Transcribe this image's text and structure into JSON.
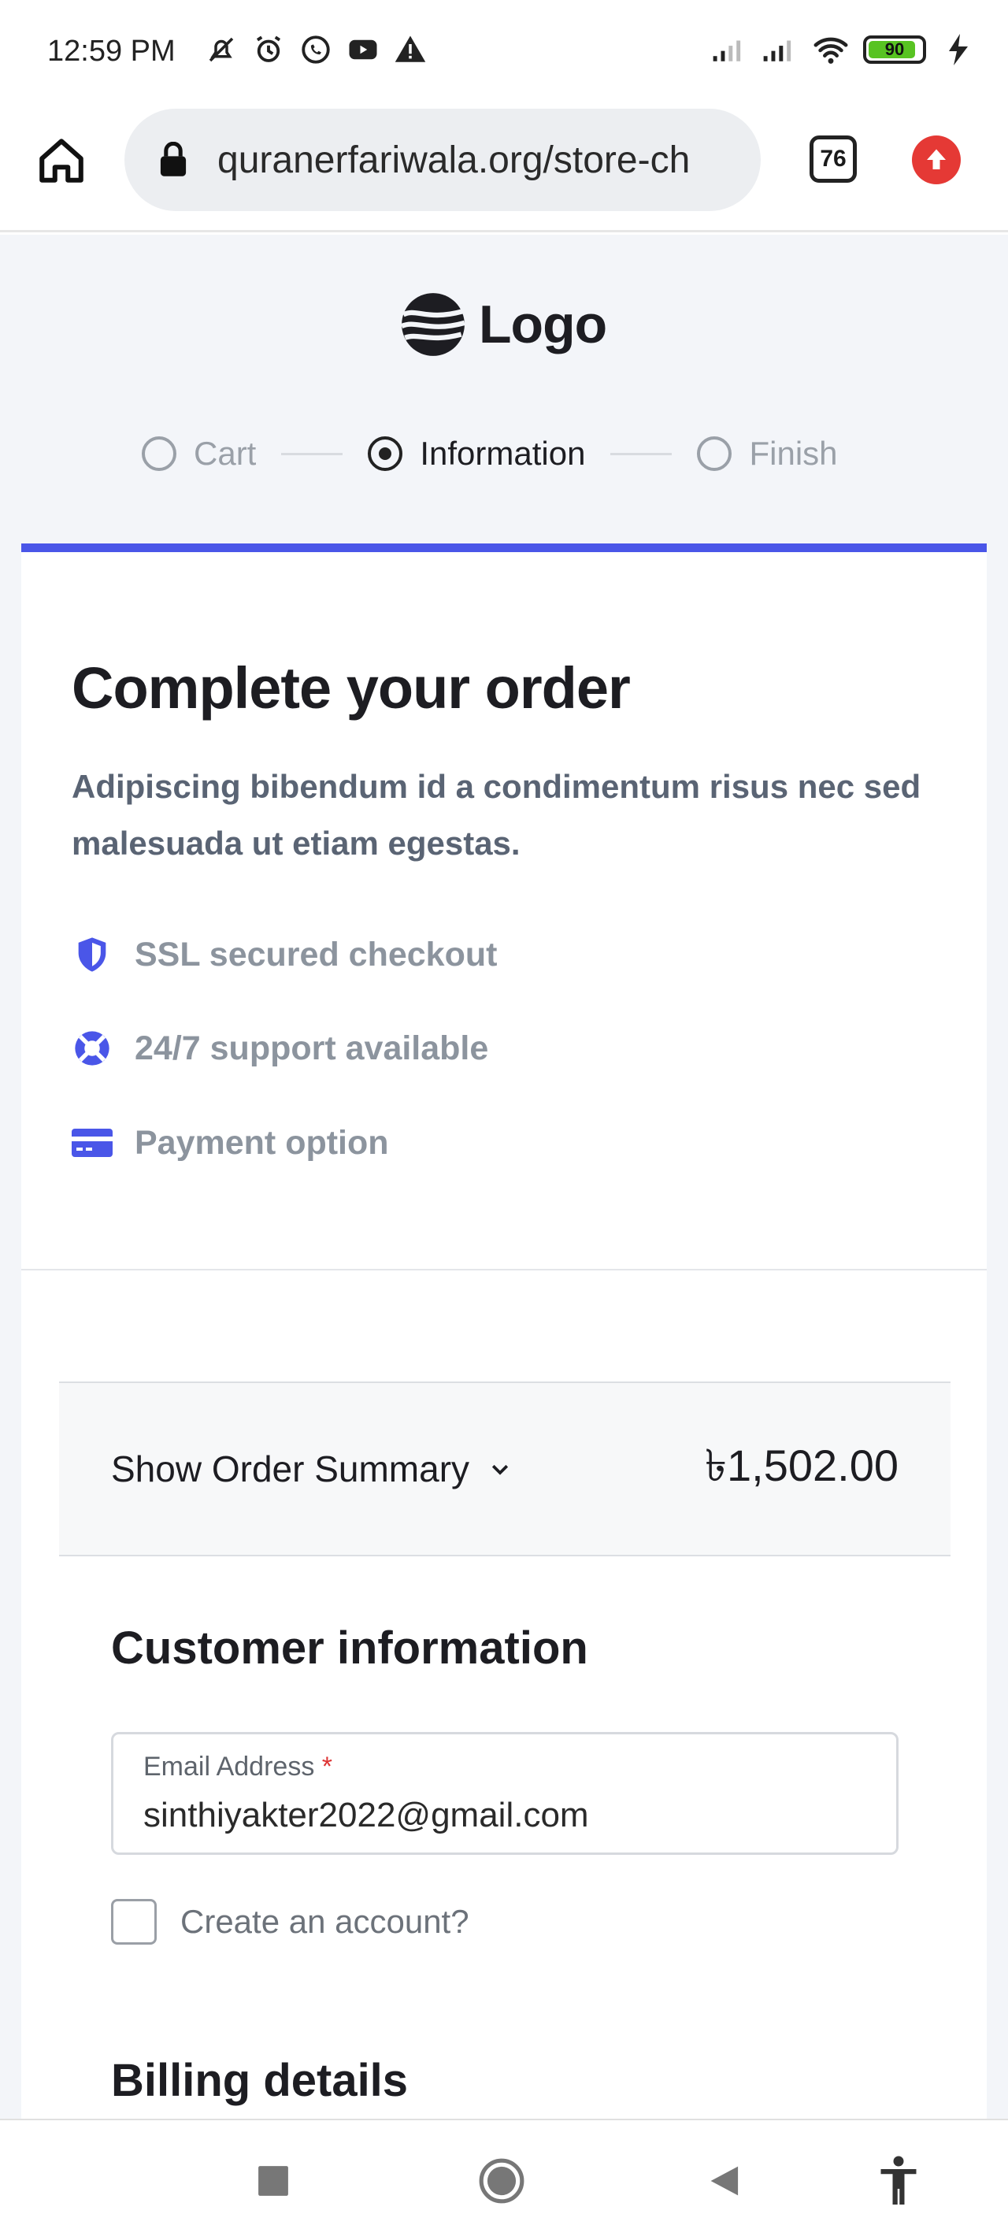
{
  "status_bar": {
    "time": "12:59 PM",
    "battery": "90",
    "battery_level": 0.9,
    "icons": [
      "mute-icon",
      "alarm-icon",
      "whatsapp-icon",
      "youtube-icon",
      "warning-icon",
      "signal-icon",
      "signal-icon",
      "wifi-icon",
      "battery-icon",
      "charging-icon"
    ]
  },
  "browser": {
    "url": "quranerfariwala.org/store-ch",
    "tab_count": "76"
  },
  "page": {
    "logo_text": "Logo",
    "steps": [
      {
        "label": "Cart",
        "state": "inactive"
      },
      {
        "label": "Information",
        "state": "active"
      },
      {
        "label": "Finish",
        "state": "inactive"
      }
    ],
    "accent_color": "#4a56e8",
    "title": "Complete your order",
    "subtitle": "Adipiscing bibendum id a condimentum risus nec sed malesuada ut etiam egestas.",
    "features": [
      {
        "icon": "shield-icon",
        "label": "SSL secured checkout"
      },
      {
        "icon": "lifebuoy-icon",
        "label": "24/7 support available"
      },
      {
        "icon": "credit-card-icon",
        "label": "Payment option"
      }
    ],
    "summary": {
      "toggle_label": "Show Order Summary",
      "total": "৳1,502.00"
    },
    "customer": {
      "title": "Customer information",
      "email_label": "Email Address",
      "required_mark": "*",
      "email_value": "sinthiyakter2022@gmail.com",
      "create_account_label": "Create an account?"
    },
    "billing": {
      "title": "Billing details"
    }
  }
}
